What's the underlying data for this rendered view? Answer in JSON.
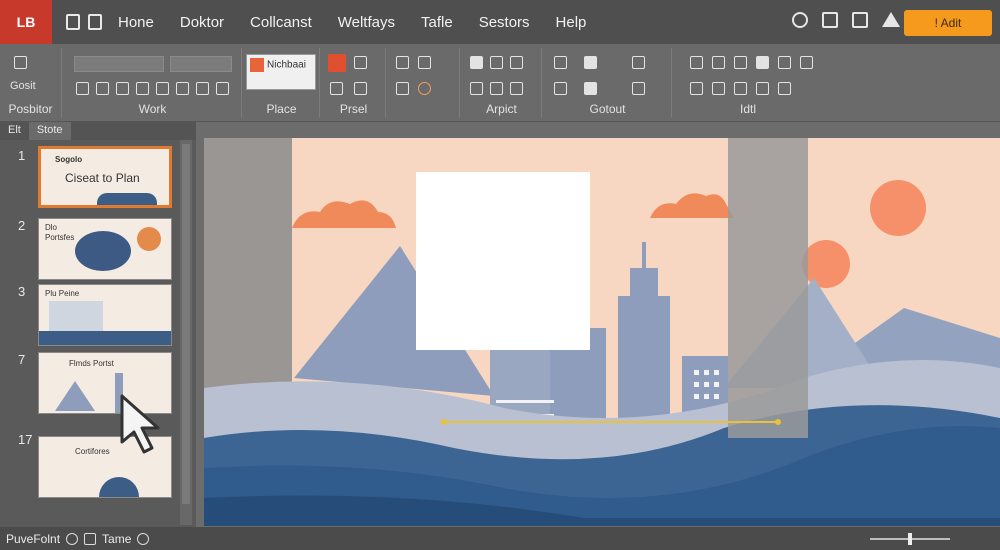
{
  "app": {
    "logo": "LB"
  },
  "menu": [
    {
      "label": "Hone"
    },
    {
      "label": "Doktor"
    },
    {
      "label": "Collcanst"
    },
    {
      "label": "Weltfays"
    },
    {
      "label": "Tafle"
    },
    {
      "label": "Sestors"
    },
    {
      "label": "Help"
    }
  ],
  "edit_button": "! Adit",
  "ribbon": {
    "groups": [
      {
        "label": "Posbitor",
        "sub": "Gosit"
      },
      {
        "label": "Work"
      },
      {
        "label": "Place"
      },
      {
        "label": "Prsel"
      },
      {
        "label": "Arpict"
      },
      {
        "label": "Gotout"
      },
      {
        "label": "Idtl"
      }
    ],
    "style_box": "Nichbaai"
  },
  "panel": {
    "tabs": [
      "Elt",
      "Stote"
    ],
    "slides": [
      {
        "num": "1",
        "title": "Ciseat to Plan",
        "header": "Sogolo"
      },
      {
        "num": "2",
        "header": "Dlo",
        "title": "Portsfes"
      },
      {
        "num": "3",
        "title": "Plu Peine"
      },
      {
        "num": "7",
        "title": "Flmds Portst"
      },
      {
        "num": "17",
        "title": "Cortifores"
      }
    ]
  },
  "status": {
    "app_name": "PuveFolnt",
    "time_label": "Tame"
  },
  "colors": {
    "accent": "#f59a1d",
    "app_red": "#c7392a",
    "selection": "#e07a2e",
    "sky": "#f7d7c2",
    "sun": "#f5a06e",
    "mountain": "#8e9dbb",
    "deep_blue": "#2f5f8f"
  }
}
